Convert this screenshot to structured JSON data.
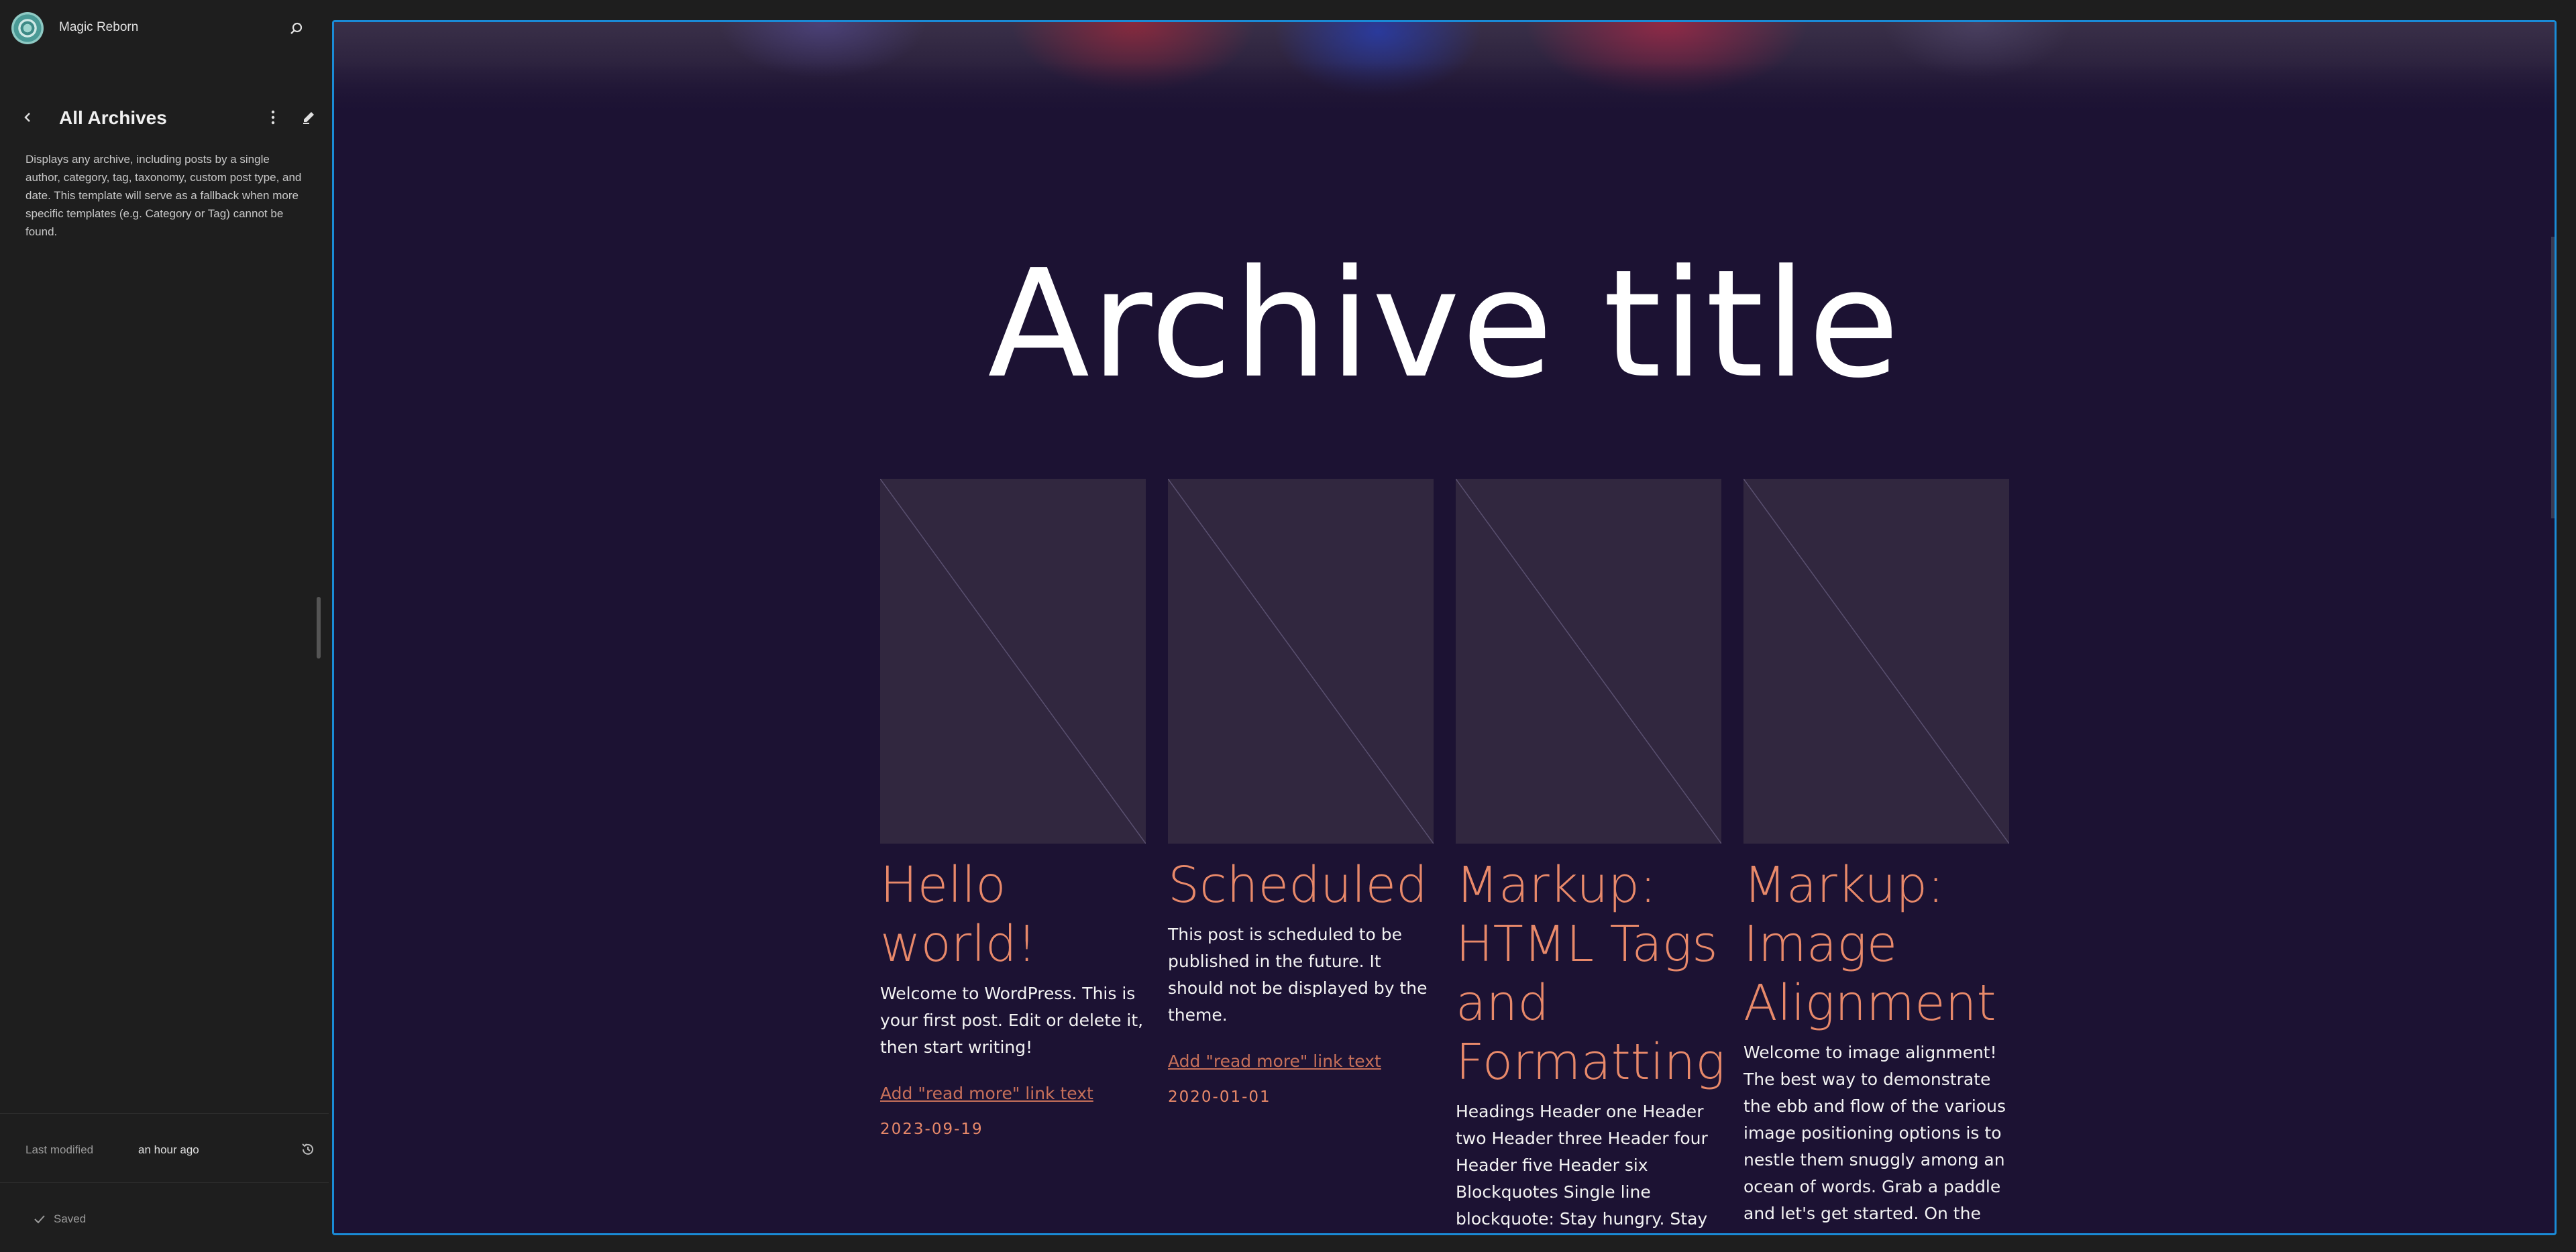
{
  "site": {
    "name": "Magic Reborn"
  },
  "sidebar": {
    "title": "All Archives",
    "description": "Displays any archive, including posts by a single author, category, tag, taxonomy, custom post type, and date. This template will serve as a fallback when more specific templates (e.g. Category or Tag) cannot be found.",
    "meta": {
      "label": "Last modified",
      "value": "an hour ago"
    },
    "saved_label": "Saved"
  },
  "canvas": {
    "archive_title": "Archive title",
    "posts": [
      {
        "title": "Hello world!",
        "excerpt": "Welcome to WordPress. This is your first post. Edit or delete it, then start writing!",
        "read_more": "Add \"read more\" link text",
        "date": "2023-09-19"
      },
      {
        "title": "Scheduled",
        "excerpt": "This post is scheduled to be published in the future. It should not be displayed by the theme.",
        "read_more": "Add \"read more\" link text",
        "date": "2020-01-01"
      },
      {
        "title": "Markup: HTML Tags and Formatting",
        "excerpt": "Headings Header one Header two Header three Header four Header five Header six Blockquotes Single line blockquote: Stay hungry. Stay foolish. Multi line",
        "read_more": "",
        "date": ""
      },
      {
        "title": "Markup: Image Alignment",
        "excerpt": "Welcome to image alignment! The best way to demonstrate the ebb and flow of the various image positioning options is to nestle them snuggly among an ocean of words. Grab a paddle and let's get started. On the topic of",
        "read_more": "",
        "date": ""
      }
    ]
  },
  "colors": {
    "accent": "#e8896a",
    "canvas_bg": "#1c1233",
    "sidebar_bg": "#1e1e1e",
    "frame": "#1a8bd6"
  }
}
